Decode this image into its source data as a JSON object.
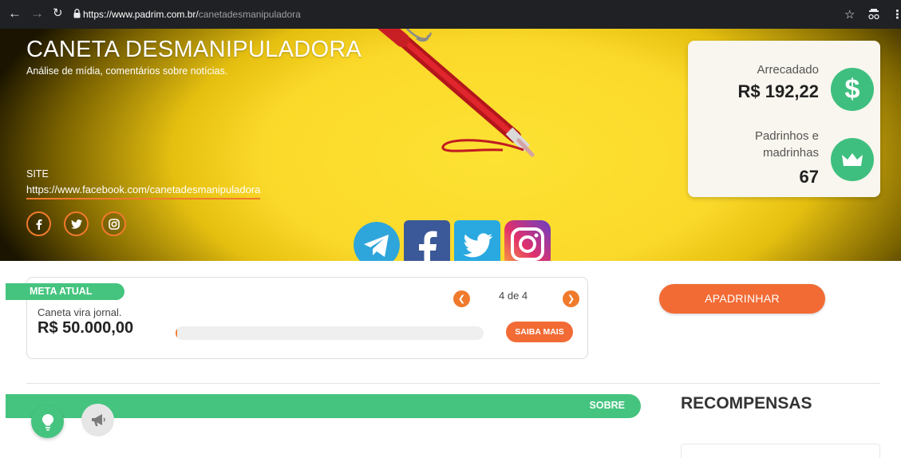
{
  "browser": {
    "url_host": "https://www.padrim.com.br/",
    "url_path": "canetadesmanipuladora"
  },
  "banner": {
    "title": "CANETA DESMANIPULADORA",
    "subtitle": "Análise de mídia, comentários sobre notícias.",
    "site_label": "SITE",
    "site_url": "https://www.facebook.com/canetadesmanipuladora",
    "social_icons": [
      "facebook-icon",
      "twitter-icon",
      "instagram-icon"
    ],
    "app_icons": [
      "telegram-icon",
      "facebook-icon",
      "twitter-icon",
      "instagram-icon"
    ]
  },
  "stats": {
    "raised_label": "Arrecadado",
    "raised_value": "R$ 192,22",
    "sponsors_label_line1": "Padrinhos e",
    "sponsors_label_line2": "madrinhas",
    "sponsors_value": "67"
  },
  "goal": {
    "tab_label": "META ATUAL",
    "description": "Caneta vira jornal.",
    "amount": "R$ 50.000,00",
    "pager": "4 de 4",
    "progress_fraction": 0.004,
    "more_button": "SAIBA MAIS"
  },
  "cta": {
    "sponsor_button": "APADRINHAR"
  },
  "about": {
    "bar_label": "SOBRE"
  },
  "rewards": {
    "title": "RECOMPENSAS"
  },
  "colors": {
    "accent_orange": "#f26b35",
    "accent_green": "#45c47f",
    "banner_yellow": "#fde233"
  }
}
